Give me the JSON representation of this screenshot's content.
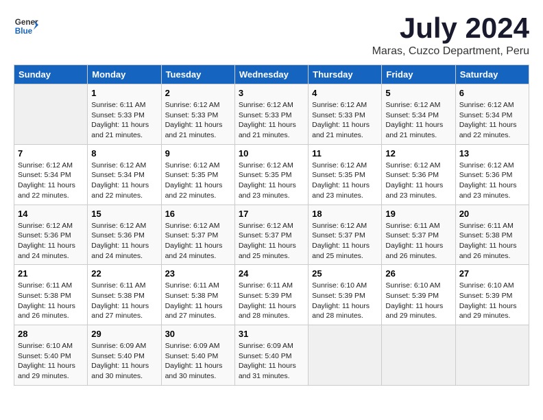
{
  "header": {
    "logo_general": "General",
    "logo_blue": "Blue",
    "month": "July 2024",
    "location": "Maras, Cuzco Department, Peru"
  },
  "days_of_week": [
    "Sunday",
    "Monday",
    "Tuesday",
    "Wednesday",
    "Thursday",
    "Friday",
    "Saturday"
  ],
  "weeks": [
    [
      {
        "day": "",
        "empty": true
      },
      {
        "day": "1",
        "sunrise": "Sunrise: 6:11 AM",
        "sunset": "Sunset: 5:33 PM",
        "daylight": "Daylight: 11 hours and 21 minutes."
      },
      {
        "day": "2",
        "sunrise": "Sunrise: 6:12 AM",
        "sunset": "Sunset: 5:33 PM",
        "daylight": "Daylight: 11 hours and 21 minutes."
      },
      {
        "day": "3",
        "sunrise": "Sunrise: 6:12 AM",
        "sunset": "Sunset: 5:33 PM",
        "daylight": "Daylight: 11 hours and 21 minutes."
      },
      {
        "day": "4",
        "sunrise": "Sunrise: 6:12 AM",
        "sunset": "Sunset: 5:33 PM",
        "daylight": "Daylight: 11 hours and 21 minutes."
      },
      {
        "day": "5",
        "sunrise": "Sunrise: 6:12 AM",
        "sunset": "Sunset: 5:34 PM",
        "daylight": "Daylight: 11 hours and 21 minutes."
      },
      {
        "day": "6",
        "sunrise": "Sunrise: 6:12 AM",
        "sunset": "Sunset: 5:34 PM",
        "daylight": "Daylight: 11 hours and 22 minutes."
      }
    ],
    [
      {
        "day": "7",
        "sunrise": "Sunrise: 6:12 AM",
        "sunset": "Sunset: 5:34 PM",
        "daylight": "Daylight: 11 hours and 22 minutes."
      },
      {
        "day": "8",
        "sunrise": "Sunrise: 6:12 AM",
        "sunset": "Sunset: 5:34 PM",
        "daylight": "Daylight: 11 hours and 22 minutes."
      },
      {
        "day": "9",
        "sunrise": "Sunrise: 6:12 AM",
        "sunset": "Sunset: 5:35 PM",
        "daylight": "Daylight: 11 hours and 22 minutes."
      },
      {
        "day": "10",
        "sunrise": "Sunrise: 6:12 AM",
        "sunset": "Sunset: 5:35 PM",
        "daylight": "Daylight: 11 hours and 23 minutes."
      },
      {
        "day": "11",
        "sunrise": "Sunrise: 6:12 AM",
        "sunset": "Sunset: 5:35 PM",
        "daylight": "Daylight: 11 hours and 23 minutes."
      },
      {
        "day": "12",
        "sunrise": "Sunrise: 6:12 AM",
        "sunset": "Sunset: 5:36 PM",
        "daylight": "Daylight: 11 hours and 23 minutes."
      },
      {
        "day": "13",
        "sunrise": "Sunrise: 6:12 AM",
        "sunset": "Sunset: 5:36 PM",
        "daylight": "Daylight: 11 hours and 23 minutes."
      }
    ],
    [
      {
        "day": "14",
        "sunrise": "Sunrise: 6:12 AM",
        "sunset": "Sunset: 5:36 PM",
        "daylight": "Daylight: 11 hours and 24 minutes."
      },
      {
        "day": "15",
        "sunrise": "Sunrise: 6:12 AM",
        "sunset": "Sunset: 5:36 PM",
        "daylight": "Daylight: 11 hours and 24 minutes."
      },
      {
        "day": "16",
        "sunrise": "Sunrise: 6:12 AM",
        "sunset": "Sunset: 5:37 PM",
        "daylight": "Daylight: 11 hours and 24 minutes."
      },
      {
        "day": "17",
        "sunrise": "Sunrise: 6:12 AM",
        "sunset": "Sunset: 5:37 PM",
        "daylight": "Daylight: 11 hours and 25 minutes."
      },
      {
        "day": "18",
        "sunrise": "Sunrise: 6:12 AM",
        "sunset": "Sunset: 5:37 PM",
        "daylight": "Daylight: 11 hours and 25 minutes."
      },
      {
        "day": "19",
        "sunrise": "Sunrise: 6:11 AM",
        "sunset": "Sunset: 5:37 PM",
        "daylight": "Daylight: 11 hours and 26 minutes."
      },
      {
        "day": "20",
        "sunrise": "Sunrise: 6:11 AM",
        "sunset": "Sunset: 5:38 PM",
        "daylight": "Daylight: 11 hours and 26 minutes."
      }
    ],
    [
      {
        "day": "21",
        "sunrise": "Sunrise: 6:11 AM",
        "sunset": "Sunset: 5:38 PM",
        "daylight": "Daylight: 11 hours and 26 minutes."
      },
      {
        "day": "22",
        "sunrise": "Sunrise: 6:11 AM",
        "sunset": "Sunset: 5:38 PM",
        "daylight": "Daylight: 11 hours and 27 minutes."
      },
      {
        "day": "23",
        "sunrise": "Sunrise: 6:11 AM",
        "sunset": "Sunset: 5:38 PM",
        "daylight": "Daylight: 11 hours and 27 minutes."
      },
      {
        "day": "24",
        "sunrise": "Sunrise: 6:11 AM",
        "sunset": "Sunset: 5:39 PM",
        "daylight": "Daylight: 11 hours and 28 minutes."
      },
      {
        "day": "25",
        "sunrise": "Sunrise: 6:10 AM",
        "sunset": "Sunset: 5:39 PM",
        "daylight": "Daylight: 11 hours and 28 minutes."
      },
      {
        "day": "26",
        "sunrise": "Sunrise: 6:10 AM",
        "sunset": "Sunset: 5:39 PM",
        "daylight": "Daylight: 11 hours and 29 minutes."
      },
      {
        "day": "27",
        "sunrise": "Sunrise: 6:10 AM",
        "sunset": "Sunset: 5:39 PM",
        "daylight": "Daylight: 11 hours and 29 minutes."
      }
    ],
    [
      {
        "day": "28",
        "sunrise": "Sunrise: 6:10 AM",
        "sunset": "Sunset: 5:40 PM",
        "daylight": "Daylight: 11 hours and 29 minutes."
      },
      {
        "day": "29",
        "sunrise": "Sunrise: 6:09 AM",
        "sunset": "Sunset: 5:40 PM",
        "daylight": "Daylight: 11 hours and 30 minutes."
      },
      {
        "day": "30",
        "sunrise": "Sunrise: 6:09 AM",
        "sunset": "Sunset: 5:40 PM",
        "daylight": "Daylight: 11 hours and 30 minutes."
      },
      {
        "day": "31",
        "sunrise": "Sunrise: 6:09 AM",
        "sunset": "Sunset: 5:40 PM",
        "daylight": "Daylight: 11 hours and 31 minutes."
      },
      {
        "day": "",
        "empty": true
      },
      {
        "day": "",
        "empty": true
      },
      {
        "day": "",
        "empty": true
      }
    ]
  ]
}
